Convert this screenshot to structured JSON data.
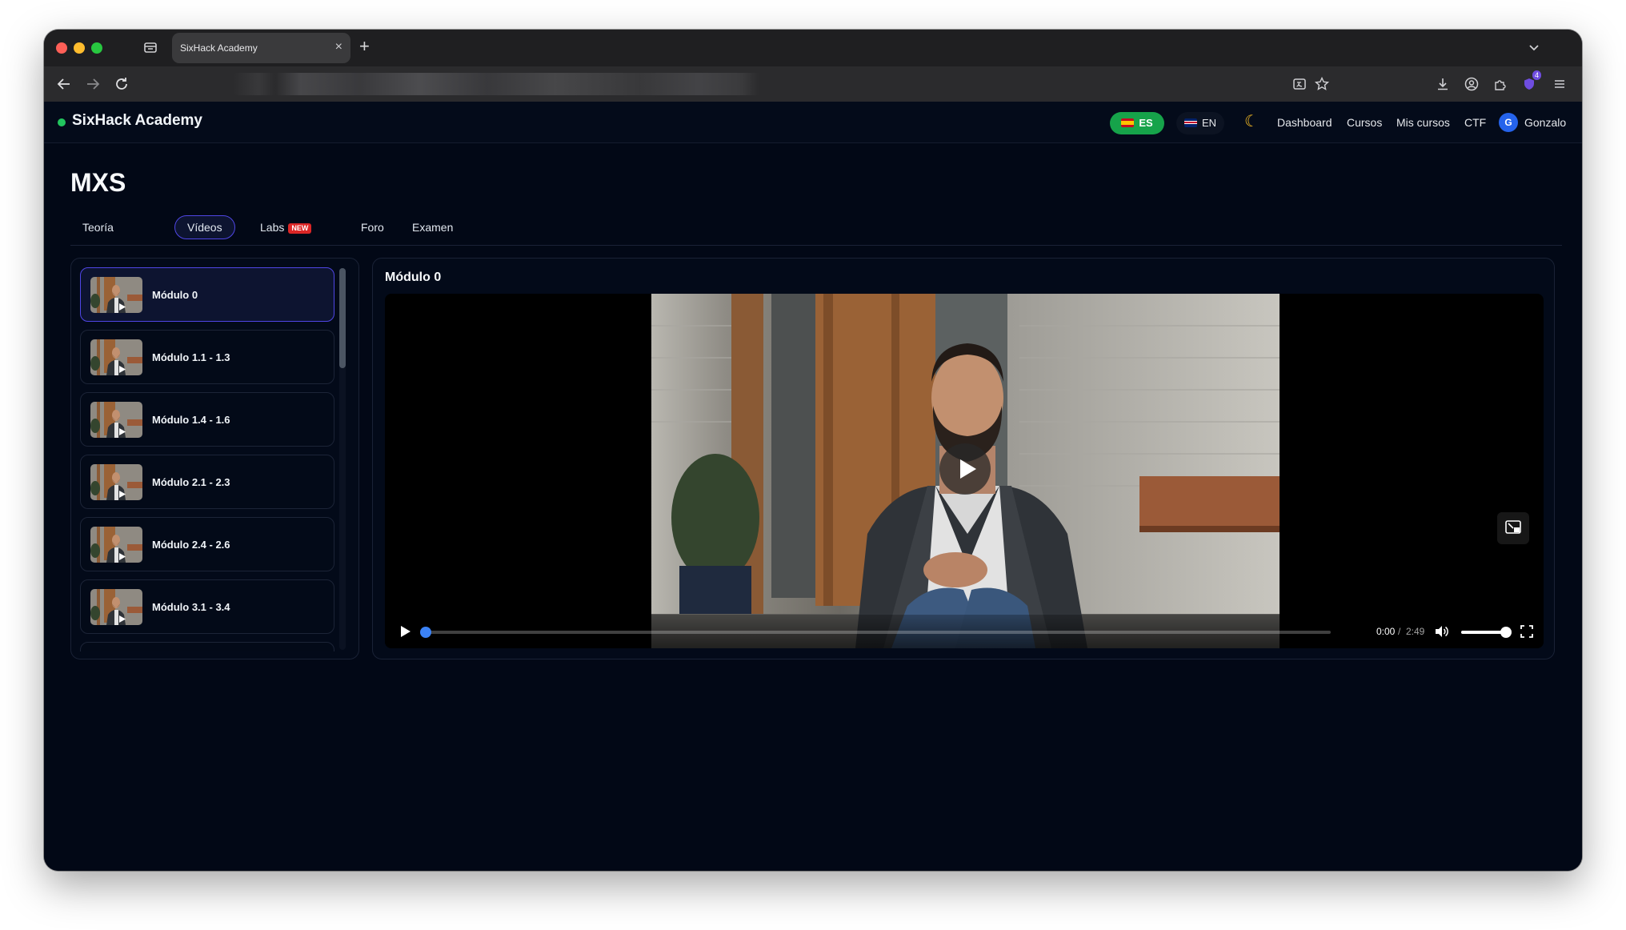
{
  "browser": {
    "tab_title": "SixHack Academy",
    "extension_badge": "4"
  },
  "header": {
    "brand": "SixHack Academy",
    "lang_es": "ES",
    "lang_en": "EN",
    "nav": [
      "Dashboard",
      "Cursos",
      "Mis cursos",
      "CTF"
    ],
    "user_initial": "G",
    "user_name": "Gonzalo"
  },
  "course": {
    "title": "MXS",
    "tabs": [
      {
        "label": "Teoría",
        "active": false
      },
      {
        "label": "Vídeos",
        "active": true
      },
      {
        "label": "Labs",
        "active": false,
        "badge": "NEW"
      },
      {
        "label": "Foro",
        "active": false
      },
      {
        "label": "Examen",
        "active": false
      }
    ]
  },
  "videos": {
    "items": [
      {
        "label": "Módulo 0",
        "active": true
      },
      {
        "label": "Módulo 1.1 - 1.3",
        "active": false
      },
      {
        "label": "Módulo 1.4 - 1.6",
        "active": false
      },
      {
        "label": "Módulo 2.1 - 2.3",
        "active": false
      },
      {
        "label": "Módulo 2.4 - 2.6",
        "active": false
      },
      {
        "label": "Módulo 3.1 - 3.4",
        "active": false
      }
    ]
  },
  "player": {
    "title": "Módulo 0",
    "time_current": "0:00",
    "time_separator": "/",
    "time_duration": "2:49",
    "progress": 0,
    "volume": 1
  },
  "colors": {
    "accent": "#4f46e5",
    "brand_status": "#22c55e",
    "lang_active": "#16a34a",
    "new_badge": "#dc2626",
    "progress": "#3b82f6"
  }
}
